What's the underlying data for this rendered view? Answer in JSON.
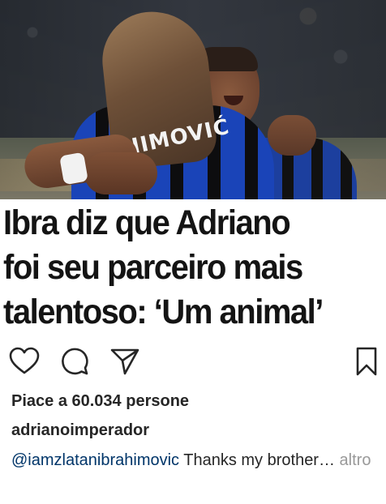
{
  "post": {
    "image": {
      "jersey_text": "AHIMOVIĆ"
    },
    "headline": {
      "lines": [
        "Ibra diz que Adriano",
        "foi seu parceiro mais",
        "talentoso: ‘Um animal’"
      ]
    },
    "actions": {
      "like_icon": "heart-icon",
      "comment_icon": "comment-icon",
      "share_icon": "paper-plane-icon",
      "save_icon": "bookmark-icon"
    },
    "likes_text": "Piace a 60.034 persone",
    "username": "adrianoimperador",
    "caption": {
      "mention": "@iamzlatanibrahimovic",
      "text": " Thanks my brother…",
      "more_label": " altro"
    },
    "colors": {
      "text": "#262626",
      "mention": "#003569",
      "muted": "#999999"
    }
  }
}
